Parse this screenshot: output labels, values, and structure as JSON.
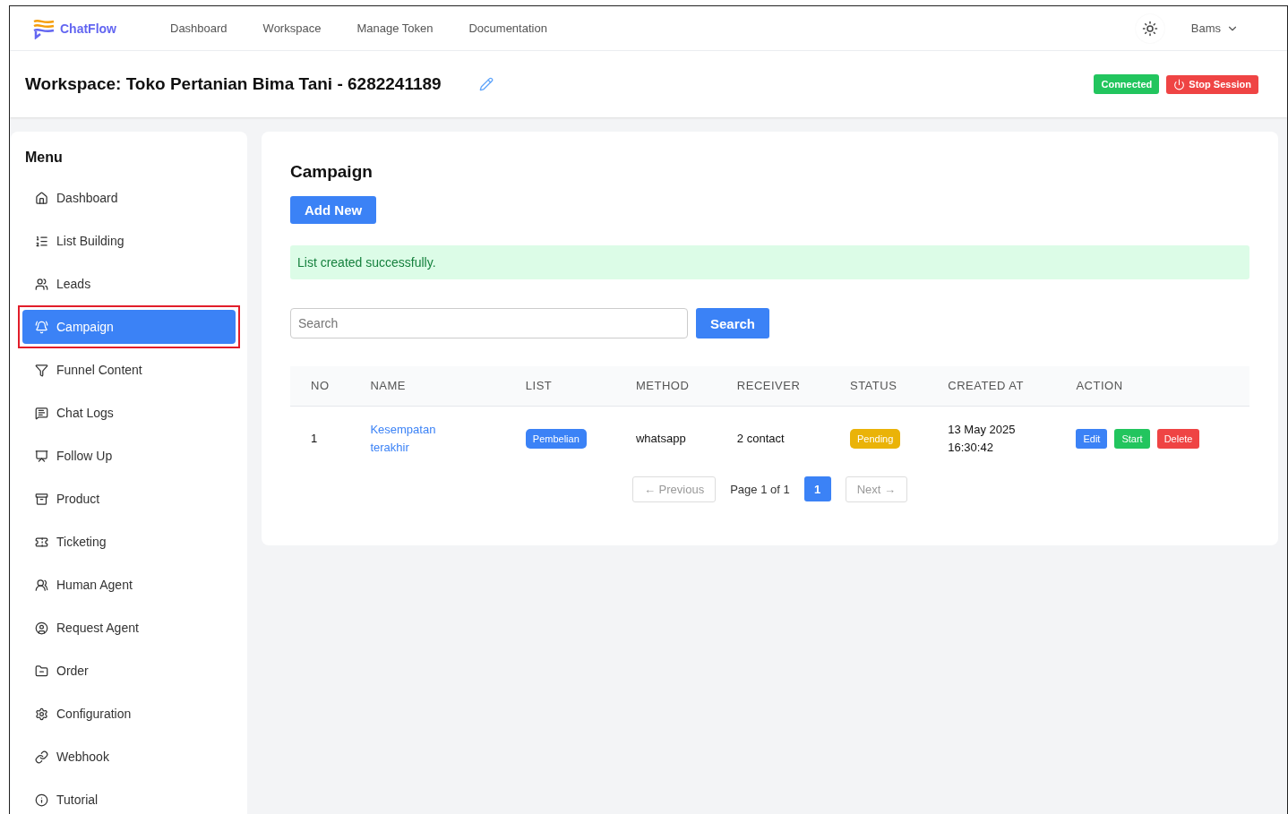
{
  "brand": "ChatFlow",
  "nav": [
    "Dashboard",
    "Workspace",
    "Manage Token",
    "Documentation"
  ],
  "user": {
    "name": "Bams"
  },
  "workspace": {
    "title": "Workspace: Toko Pertanian Bima Tani - 6282241189",
    "status": "Connected",
    "stop_button": "Stop Session"
  },
  "sidebar": {
    "title": "Menu",
    "items": [
      {
        "label": "Dashboard",
        "selected": false,
        "highlighted": false
      },
      {
        "label": "List Building",
        "selected": false,
        "highlighted": false
      },
      {
        "label": "Leads",
        "selected": false,
        "highlighted": false
      },
      {
        "label": "Campaign",
        "selected": true,
        "highlighted": true
      },
      {
        "label": "Funnel Content",
        "selected": false,
        "highlighted": false
      },
      {
        "label": "Chat Logs",
        "selected": false,
        "highlighted": false
      },
      {
        "label": "Follow Up",
        "selected": false,
        "highlighted": false
      },
      {
        "label": "Product",
        "selected": false,
        "highlighted": false
      },
      {
        "label": "Ticketing",
        "selected": false,
        "highlighted": false
      },
      {
        "label": "Human Agent",
        "selected": false,
        "highlighted": false
      },
      {
        "label": "Request Agent",
        "selected": false,
        "highlighted": false
      },
      {
        "label": "Order",
        "selected": false,
        "highlighted": false
      },
      {
        "label": "Configuration",
        "selected": false,
        "highlighted": false
      },
      {
        "label": "Webhook",
        "selected": false,
        "highlighted": false
      },
      {
        "label": "Tutorial",
        "selected": false,
        "highlighted": false
      }
    ]
  },
  "content": {
    "title": "Campaign",
    "add_button": "Add New",
    "alert": "List created successfully.",
    "search": {
      "placeholder": "Search",
      "button": "Search"
    },
    "table": {
      "columns": [
        "NO",
        "NAME",
        "LIST",
        "METHOD",
        "RECEIVER",
        "STATUS",
        "CREATED AT",
        "ACTION"
      ],
      "rows": [
        {
          "no": "1",
          "name": "Kesempatan terakhir",
          "list": "Pembelian",
          "method": "whatsapp",
          "receiver": "2 contact",
          "status": "Pending",
          "created_at": [
            "13 May 2025",
            "16:30:42"
          ],
          "actions": [
            {
              "label": "Edit",
              "kind": "edit"
            },
            {
              "label": "Start",
              "kind": "start"
            },
            {
              "label": "Delete",
              "kind": "delete"
            }
          ]
        }
      ]
    },
    "pagination": {
      "previous": "← Previous",
      "info": "Page 1 of 1",
      "pages": [
        {
          "label": "1",
          "selected": true
        }
      ],
      "next": "Next →"
    }
  }
}
